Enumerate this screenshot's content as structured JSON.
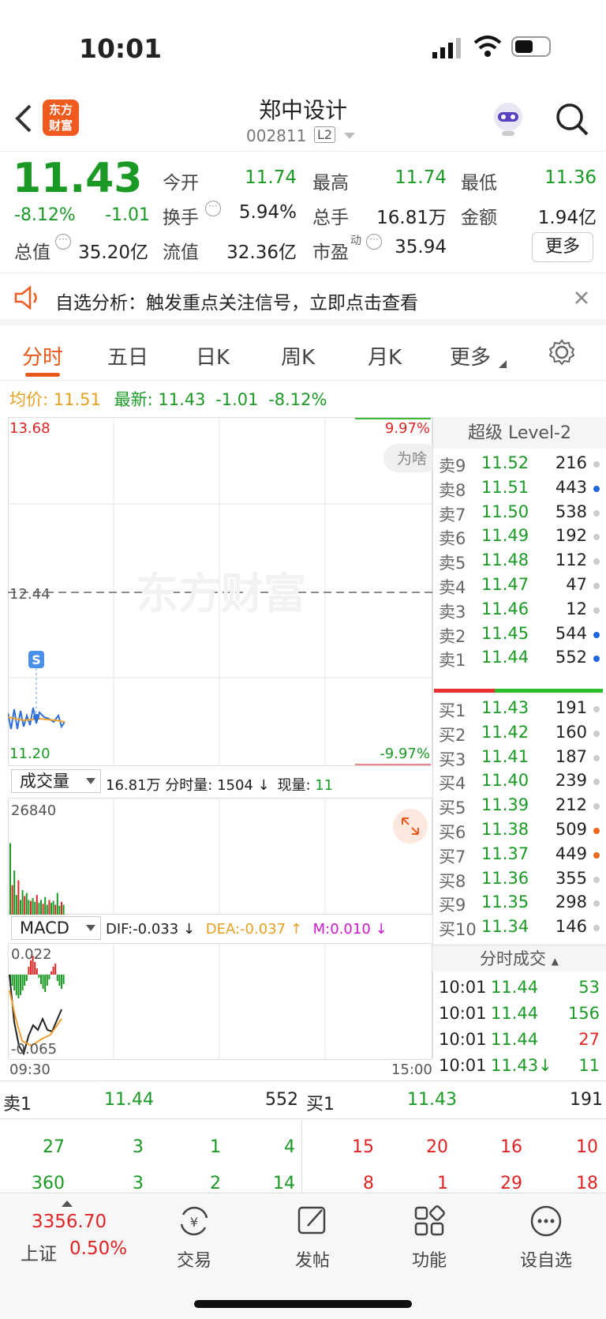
{
  "status": {
    "time": "10:01"
  },
  "header": {
    "name": "郑中设计",
    "code": "002811",
    "level": "L2",
    "logo_line1": "东方",
    "logo_line2": "财富"
  },
  "quote": {
    "price": "11.43",
    "pct": "-8.12%",
    "chg": "-1.01",
    "open_label": "今开",
    "open": "11.74",
    "high_label": "最高",
    "high": "11.74",
    "low_label": "最低",
    "low": "11.36",
    "turnover_label": "换手",
    "turnover": "5.94%",
    "volume_label": "总手",
    "volume": "16.81万",
    "amount_label": "金额",
    "amount": "1.94亿",
    "mcap_label": "总值",
    "mcap": "35.20亿",
    "float_label": "流值",
    "float": "32.36亿",
    "pe_label": "市盈",
    "pe_sup": "动",
    "pe": "35.94",
    "more_button": "更多"
  },
  "notice": {
    "text": "自选分析：触发重点关注信号，立即点击查看"
  },
  "tabs": [
    "分时",
    "五日",
    "日K",
    "周K",
    "月K",
    "更多"
  ],
  "infoline": {
    "avg_label": "均价:",
    "avg": "11.51",
    "latest_label": "最新:",
    "latest": "11.43",
    "chg": "-1.01",
    "pct": "-8.12%"
  },
  "chart": {
    "ymax": "13.68",
    "ymid": "12.44",
    "ymin": "11.20",
    "pmax": "9.97%",
    "pmin": "-9.97%",
    "watermark": "东方财富",
    "hint": "为啥",
    "marker": "S",
    "start": "09:30",
    "end": "15:00"
  },
  "vol": {
    "selector": "成交量",
    "total": "16.81万",
    "minute_label": "分时量:",
    "minute": "1504",
    "now_label": "现量:",
    "now": "11",
    "max": "26840"
  },
  "macd": {
    "selector": "MACD",
    "dif": "DIF:-0.033",
    "dea": "DEA:-0.037",
    "m": "M:0.010",
    "max": "0.022",
    "min": "-0.065"
  },
  "level2": {
    "title": "超级 Level-2",
    "sell": [
      {
        "l": "卖9",
        "p": "11.52",
        "v": "216",
        "d": "#ccc"
      },
      {
        "l": "卖8",
        "p": "11.51",
        "v": "443",
        "d": "#2266dd"
      },
      {
        "l": "卖7",
        "p": "11.50",
        "v": "538",
        "d": "#ccc"
      },
      {
        "l": "卖6",
        "p": "11.49",
        "v": "192",
        "d": "#ccc"
      },
      {
        "l": "卖5",
        "p": "11.48",
        "v": "112",
        "d": "#ccc"
      },
      {
        "l": "卖4",
        "p": "11.47",
        "v": "47",
        "d": "#ccc"
      },
      {
        "l": "卖3",
        "p": "11.46",
        "v": "12",
        "d": "#ccc"
      },
      {
        "l": "卖2",
        "p": "11.45",
        "v": "544",
        "d": "#2266dd"
      },
      {
        "l": "卖1",
        "p": "11.44",
        "v": "552",
        "d": "#2266dd"
      }
    ],
    "buy": [
      {
        "l": "买1",
        "p": "11.43",
        "v": "191",
        "d": "#ccc"
      },
      {
        "l": "买2",
        "p": "11.42",
        "v": "160",
        "d": "#ccc"
      },
      {
        "l": "买3",
        "p": "11.41",
        "v": "187",
        "d": "#ccc"
      },
      {
        "l": "买4",
        "p": "11.40",
        "v": "239",
        "d": "#ccc"
      },
      {
        "l": "买5",
        "p": "11.39",
        "v": "212",
        "d": "#ccc"
      },
      {
        "l": "买6",
        "p": "11.38",
        "v": "509",
        "d": "#e86a1a"
      },
      {
        "l": "买7",
        "p": "11.37",
        "v": "449",
        "d": "#e86a1a"
      },
      {
        "l": "买8",
        "p": "11.36",
        "v": "355",
        "d": "#ccc"
      },
      {
        "l": "买9",
        "p": "11.35",
        "v": "298",
        "d": "#ccc"
      },
      {
        "l": "买10",
        "p": "11.34",
        "v": "146",
        "d": "#ccc"
      }
    ]
  },
  "ticks": {
    "title": "分时成交",
    "rows": [
      {
        "t": "10:01",
        "p": "11.44",
        "v": "53",
        "c": "g"
      },
      {
        "t": "10:01",
        "p": "11.44",
        "v": "156",
        "c": "g"
      },
      {
        "t": "10:01",
        "p": "11.44",
        "v": "27",
        "c": "r"
      },
      {
        "t": "10:01",
        "p": "11.43↓",
        "v": "11",
        "c": "g"
      }
    ]
  },
  "bottombook": {
    "sell_label": "卖1",
    "sell_price": "11.44",
    "sell_vol": "552",
    "buy_label": "买1",
    "buy_price": "11.43",
    "buy_vol": "191",
    "sell_r1": [
      "27",
      "3",
      "1",
      "4"
    ],
    "sell_r2": [
      "360",
      "3",
      "2",
      "14"
    ],
    "buy_r1": [
      "15",
      "20",
      "16",
      "10"
    ],
    "buy_r2": [
      "8",
      "1",
      "29",
      "18"
    ]
  },
  "nav": {
    "index_value": "3356.70",
    "index_name": "上证",
    "index_pct": "0.50%",
    "items": [
      "交易",
      "发帖",
      "功能",
      "设自选"
    ]
  }
}
